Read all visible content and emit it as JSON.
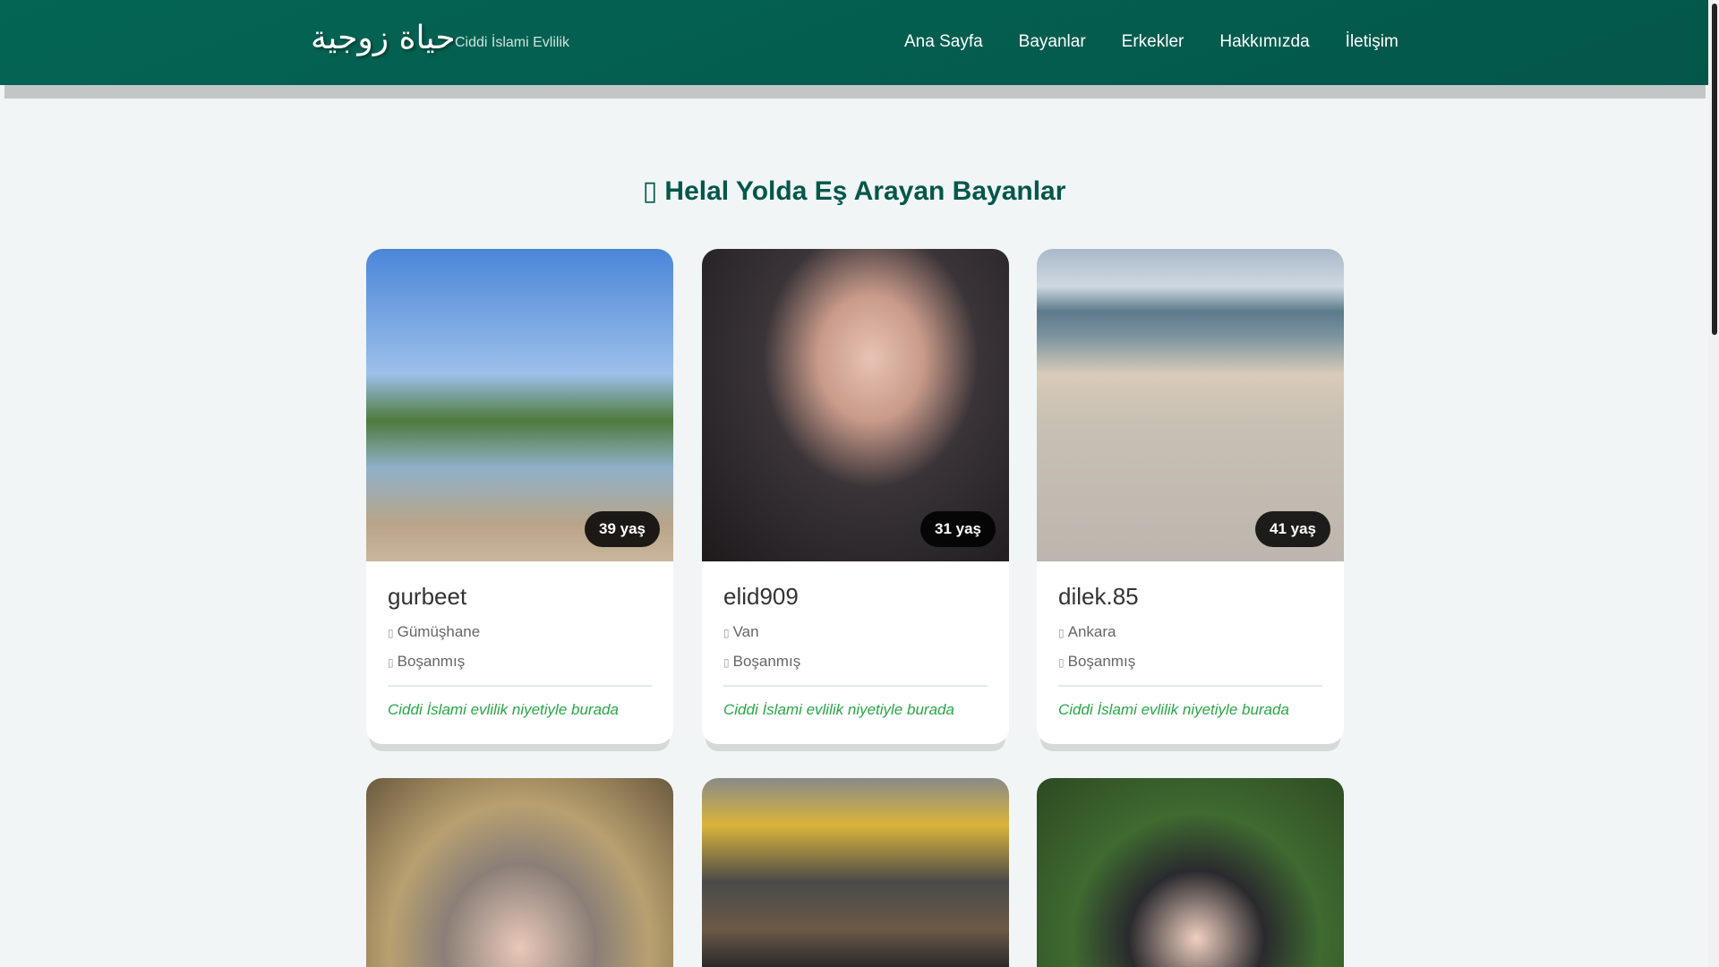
{
  "header": {
    "logo": "حياة زوجية",
    "tagline": "Ciddi İslami Evlilik",
    "nav": [
      "Ana Sayfa",
      "Bayanlar",
      "Erkekler",
      "Hakkımızda",
      "İletişim"
    ]
  },
  "section": {
    "icon": "female-icon",
    "title": "Helal Yolda Eş Arayan Bayanlar"
  },
  "profiles": [
    {
      "age": "39 yaş",
      "name": "gurbeet",
      "city": "Gümüşhane",
      "status": "Boşanmış",
      "note": "Ciddi İslami evlilik niyetiyle burada"
    },
    {
      "age": "31 yaş",
      "name": "elid909",
      "city": "Van",
      "status": "Boşanmış",
      "note": "Ciddi İslami evlilik niyetiyle burada"
    },
    {
      "age": "41 yaş",
      "name": "dilek.85",
      "city": "Ankara",
      "status": "Boşanmış",
      "note": "Ciddi İslami evlilik niyetiyle burada"
    }
  ]
}
